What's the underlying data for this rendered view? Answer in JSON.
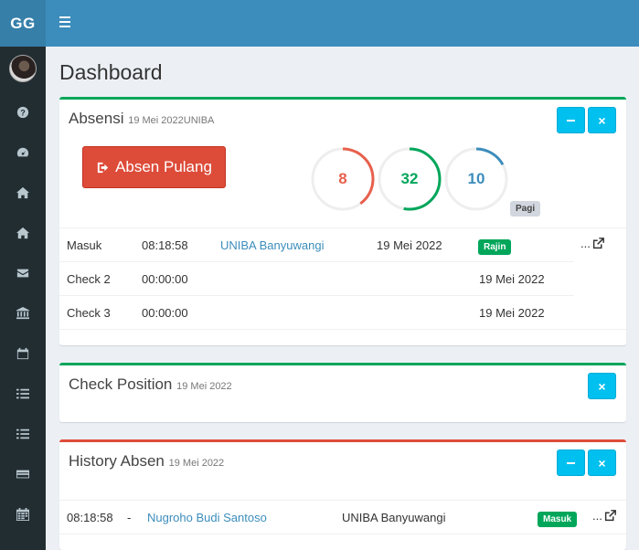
{
  "header": {
    "logo": "GG"
  },
  "sidebar": {
    "icons": [
      "question-circle-icon",
      "dashboard-icon",
      "home-icon",
      "home-icon",
      "envelope-icon",
      "bank-icon",
      "calendar-icon",
      "list-icon",
      "list-icon",
      "credit-card-icon",
      "calendar-grid-icon"
    ]
  },
  "page": {
    "title": "Dashboard"
  },
  "absensi": {
    "title": "Absensi",
    "subtitle": "19 Mei 2022UNIBA",
    "button_label": "Absen Pulang",
    "rings": [
      {
        "value": "8",
        "color": "#e8604c",
        "fraction": 0.4
      },
      {
        "value": "32",
        "color": "#00a65a",
        "fraction": 0.53
      },
      {
        "value": "10",
        "color": "#3c8dbc",
        "fraction": 0.17
      }
    ],
    "session_badge": "Pagi",
    "rows": [
      {
        "label": "Masuk",
        "time": "08:18:58",
        "location": "UNIBA Banyuwangi",
        "date": "19 Mei 2022",
        "status": "Rajin",
        "action": "..."
      },
      {
        "label": "Check 2",
        "time": "00:00:00",
        "location": "",
        "date": "19 Mei 2022"
      },
      {
        "label": "Check 3",
        "time": "00:00:00",
        "location": "",
        "date": "19 Mei 2022"
      }
    ]
  },
  "check_position": {
    "title": "Check Position",
    "subtitle": "19 Mei 2022"
  },
  "history": {
    "title": "History Absen",
    "subtitle": "19 Mei 2022",
    "rows": [
      {
        "time": "08:18:58",
        "separator": "-",
        "name": "Nugroho Budi Santoso",
        "location": "UNIBA Banyuwangi",
        "status": "Masuk",
        "action": "..."
      }
    ]
  },
  "colors": {
    "primary": "#3c8dbc",
    "success": "#00a65a",
    "danger": "#dd4b39",
    "info": "#00c0ef",
    "sidebar": "#222d32"
  }
}
